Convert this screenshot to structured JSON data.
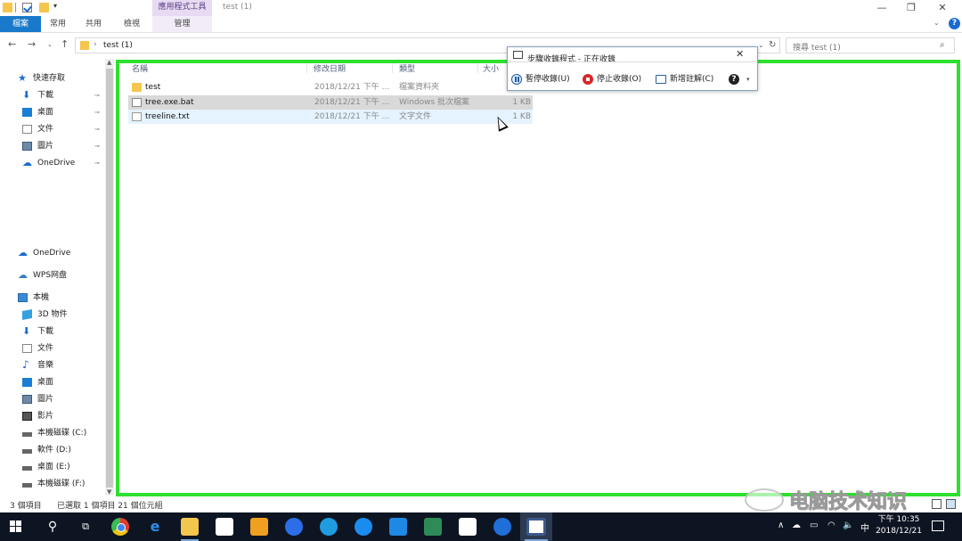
{
  "window": {
    "title": "test (1)",
    "context_tab_group": "應用程式工具",
    "quick_access_dropdown": "▾",
    "min": "—",
    "max": "❐",
    "close": "✕"
  },
  "ribbon": {
    "tabs": [
      "檔案",
      "常用",
      "共用",
      "檢視",
      "管理"
    ],
    "expand": "⌄",
    "help": "?"
  },
  "address": {
    "back": "←",
    "forward": "→",
    "recent": "⌄",
    "up": "↑",
    "separator": "›",
    "path": "test (1)",
    "dropdown": "⌄",
    "refresh": "↻",
    "search_placeholder": "搜尋 test (1)",
    "search_icon": "⌕"
  },
  "navpane": {
    "items": [
      {
        "label": "快速存取",
        "icon": "star-icon",
        "glyph": "★",
        "pinned": false
      },
      {
        "label": "下載",
        "icon": "download-icon",
        "glyph": "⬇",
        "pinned": true
      },
      {
        "label": "桌面",
        "icon": "desktop-icon",
        "glyph": "",
        "pinned": true
      },
      {
        "label": "文件",
        "icon": "document-icon",
        "glyph": "",
        "pinned": true
      },
      {
        "label": "圖片",
        "icon": "pictures-icon",
        "glyph": "",
        "pinned": true
      },
      {
        "label": "OneDrive",
        "icon": "onedrive-icon",
        "glyph": "☁",
        "pinned": true
      },
      {
        "label": "OneDrive",
        "icon": "onedrive-icon",
        "glyph": "☁",
        "pinned": false
      },
      {
        "label": "WPS网盘",
        "icon": "wps-cloud-icon",
        "glyph": "☁",
        "pinned": false
      },
      {
        "label": "本機",
        "icon": "this-pc-icon",
        "glyph": "",
        "pinned": false
      },
      {
        "label": "3D 物件",
        "icon": "3d-objects-icon",
        "glyph": "",
        "pinned": false
      },
      {
        "label": "下載",
        "icon": "download-icon",
        "glyph": "⬇",
        "pinned": false
      },
      {
        "label": "文件",
        "icon": "document-icon",
        "glyph": "",
        "pinned": false
      },
      {
        "label": "音樂",
        "icon": "music-icon",
        "glyph": "♪",
        "pinned": false
      },
      {
        "label": "桌面",
        "icon": "desktop-icon",
        "glyph": "",
        "pinned": false
      },
      {
        "label": "圖片",
        "icon": "pictures-icon",
        "glyph": "",
        "pinned": false
      },
      {
        "label": "影片",
        "icon": "videos-icon",
        "glyph": "",
        "pinned": false
      },
      {
        "label": "本機磁碟 (C:)",
        "icon": "drive-icon",
        "glyph": "",
        "pinned": false
      },
      {
        "label": "軟件 (D:)",
        "icon": "drive-icon",
        "glyph": "",
        "pinned": false
      },
      {
        "label": "桌面 (E:)",
        "icon": "drive-icon",
        "glyph": "",
        "pinned": false
      },
      {
        "label": "本機磁碟 (F:)",
        "icon": "drive-icon",
        "glyph": "",
        "pinned": false
      }
    ],
    "pin_glyph": "📌"
  },
  "filelist": {
    "columns": [
      "名稱",
      "修改日期",
      "類型",
      "大小"
    ],
    "rows": [
      {
        "name": "test",
        "date": "2018/12/21 下午 ...",
        "type": "檔案資料夾",
        "size": "",
        "icon": "folder-icon",
        "state": "normal"
      },
      {
        "name": "tree.exe.bat",
        "date": "2018/12/21 下午 ...",
        "type": "Windows 批次檔案",
        "size": "1 KB",
        "icon": "batch-file-icon",
        "state": "selected"
      },
      {
        "name": "treeline.txt",
        "date": "2018/12/21 下午 ...",
        "type": "文字文件",
        "size": "1 KB",
        "icon": "text-file-icon",
        "state": "hover"
      }
    ]
  },
  "recorder": {
    "title": "步驟收錄程式 - 正在收錄",
    "close": "✕",
    "pause": "暫停收錄(U)",
    "stop": "停止收錄(O)",
    "comment": "新增註解(C)",
    "help": "?",
    "help_caret": "▾"
  },
  "statusbar": {
    "count": "3 個項目",
    "selected": "已選取 1 個項目 21 個位元組"
  },
  "watermark": {
    "text": "电脑技术知识"
  },
  "taskbar": {
    "search_glyph": "⚲",
    "taskview_glyph": "⧉",
    "edge_glyph": "e",
    "tray_up": "∧",
    "tray_cloud": "☁",
    "tray_net": "▭",
    "tray_wifi": "◠",
    "tray_vol": "🔈",
    "ime": "中",
    "clock_time": "下午 10:35",
    "clock_date": "2018/12/21"
  }
}
